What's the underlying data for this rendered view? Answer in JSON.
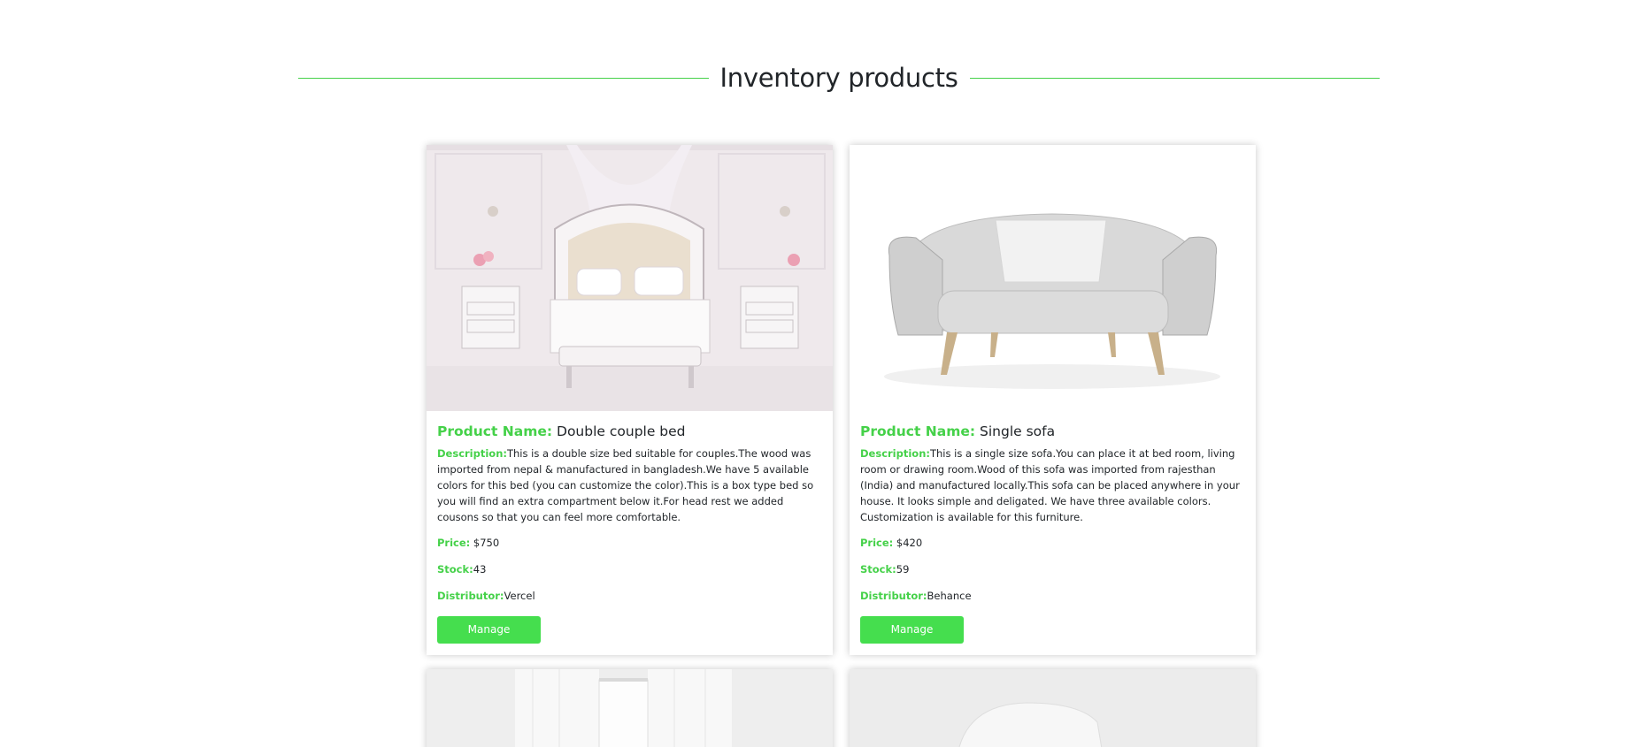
{
  "section": {
    "title": "Inventory products"
  },
  "labels": {
    "product_name": "Product Name:",
    "description": "Description:",
    "price": "Price:",
    "stock": "Stock:",
    "distributor": "Distributor:",
    "manage": "Manage"
  },
  "products": [
    {
      "name": "Double couple bed",
      "description": "This is a double size bed suitable for couples.The wood was imported from nepal & manufactured in bangladesh.We have 5 available colors for this bed (you can customize the color).This is a box type bed so you will find an extra compartment below it.For head rest we added cousons so that you can feel more comfortable.",
      "price": "$750",
      "stock": "43",
      "distributor": "Vercel"
    },
    {
      "name": "Single sofa",
      "description": "This is a single size sofa.You can place it at bed room, living room or drawing room.Wood of this sofa was imported from rajesthan (India) and manufactured locally.This sofa can be placed anywhere in your house. It looks simple and deligated. We have three available colors. Customization is available for this furniture.",
      "price": "$420",
      "stock": "59",
      "distributor": "Behance"
    }
  ],
  "colors": {
    "accent": "#45d149",
    "button": "#45de4e",
    "text": "#212529"
  }
}
